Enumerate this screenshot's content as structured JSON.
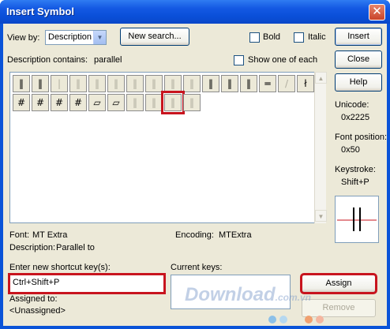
{
  "window": {
    "title": "Insert Symbol",
    "close_glyph": "✕"
  },
  "controls": {
    "view_by_label": "View by:",
    "view_by_value": "Description",
    "new_search_label": "New search...",
    "bold_label": "Bold",
    "italic_label": "Italic",
    "description_contains_label": "Description contains:",
    "description_contains_value": "parallel",
    "show_one_label": "Show one of each"
  },
  "buttons": {
    "insert": "Insert",
    "close": "Close",
    "help": "Help",
    "assign": "Assign",
    "remove": "Remove"
  },
  "symbols": {
    "row1": [
      "‖",
      "‖",
      "|",
      "‖",
      "‖",
      "‖",
      "‖",
      "‖",
      "‖",
      "‖",
      "‖",
      "‖",
      "‖",
      "═",
      "/",
      "ł"
    ],
    "row2": [
      "#",
      "#",
      "#",
      "#",
      "▱",
      "▱",
      "‖",
      "‖",
      "‖",
      "‖"
    ]
  },
  "info": {
    "unicode_label": "Unicode:",
    "unicode_value": "0x2225",
    "font_position_label": "Font position:",
    "font_position_value": "0x50",
    "keystroke_label": "Keystroke:",
    "keystroke_value": "Shift+P",
    "font_label": "Font:",
    "font_value": "MT Extra",
    "encoding_label": "Encoding:",
    "encoding_value": "MTExtra",
    "description_label": "Description:",
    "description_value": "Parallel to"
  },
  "shortcut": {
    "enter_label": "Enter new shortcut key(s):",
    "input_value": "Ctrl+Shift+P",
    "current_keys_label": "Current keys:",
    "assigned_to_label": "Assigned to:",
    "assigned_to_value": "<Unassigned>"
  },
  "watermark": {
    "text": "Download",
    "suffix": ".com.vn"
  },
  "colors": {
    "highlight": "#c8141e",
    "title_blue": "#0a53d8"
  }
}
